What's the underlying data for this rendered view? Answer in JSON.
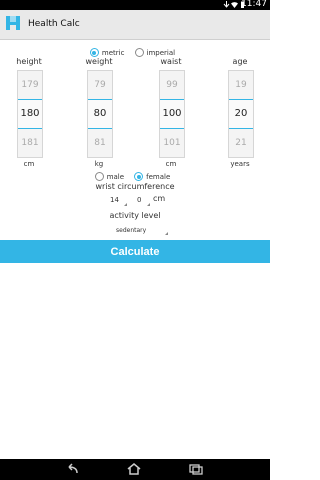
{
  "status": {
    "time": "11:47"
  },
  "app": {
    "title": "Health Calc"
  },
  "units": {
    "metric": "metric",
    "imperial": "imperial",
    "selected": "metric"
  },
  "pickers": {
    "height": {
      "label": "height",
      "prev": "179",
      "value": "180",
      "next": "181",
      "unit": "cm"
    },
    "weight": {
      "label": "weight",
      "prev": "79",
      "value": "80",
      "next": "81",
      "unit": "kg"
    },
    "waist": {
      "label": "waist",
      "prev": "99",
      "value": "100",
      "next": "101",
      "unit": "cm"
    },
    "age": {
      "label": "age",
      "prev": "19",
      "value": "20",
      "next": "21",
      "unit": "years"
    }
  },
  "sex": {
    "male": "male",
    "female": "female",
    "selected": "female"
  },
  "wrist": {
    "label": "wrist circumference",
    "whole": "14",
    "fraction": "0",
    "unit": "cm"
  },
  "activity": {
    "label": "activity level",
    "value": "sedentary"
  },
  "calculate": {
    "label": "Calculate"
  },
  "icons": {
    "app": "heart-icon",
    "back": "back-icon",
    "home": "home-icon",
    "recents": "recents-icon"
  },
  "colors": {
    "accent": "#33b5e5"
  }
}
